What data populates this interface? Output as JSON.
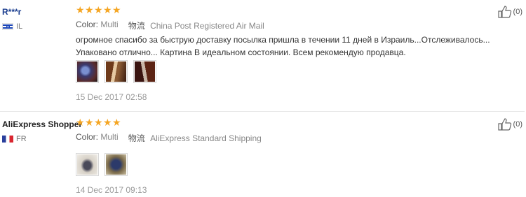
{
  "reviews": [
    {
      "user": "R***r",
      "country": "IL",
      "rating": 5,
      "color_label": "Color:",
      "color_value": "Multi",
      "shipping_icon_text": "物流",
      "shipping": "China Post Registered Air Mail",
      "text": "огромное спасибо за быструю доставку посылка пришла в течении 11 дней в Израиль...Отслеживалось... Упаковано отлично... Картина В идеальном состоянии. Всем рекомендую продавца.",
      "date": "15 Dec 2017 02:58",
      "helpful": "(0)",
      "photos": 3
    },
    {
      "user": "AliExpress Shopper",
      "country": "FR",
      "rating": 5,
      "color_label": "Color:",
      "color_value": "Multi",
      "shipping_icon_text": "物流",
      "shipping": "AliExpress Standard Shipping",
      "date": "14 Dec 2017 09:13",
      "helpful": "(0)",
      "photos": 2
    }
  ],
  "icons": {
    "star": "star-icon",
    "thumbs_up": "thumbs-up-icon"
  },
  "colors": {
    "star": "#f5a623",
    "username_link": "#1a3d8f"
  }
}
